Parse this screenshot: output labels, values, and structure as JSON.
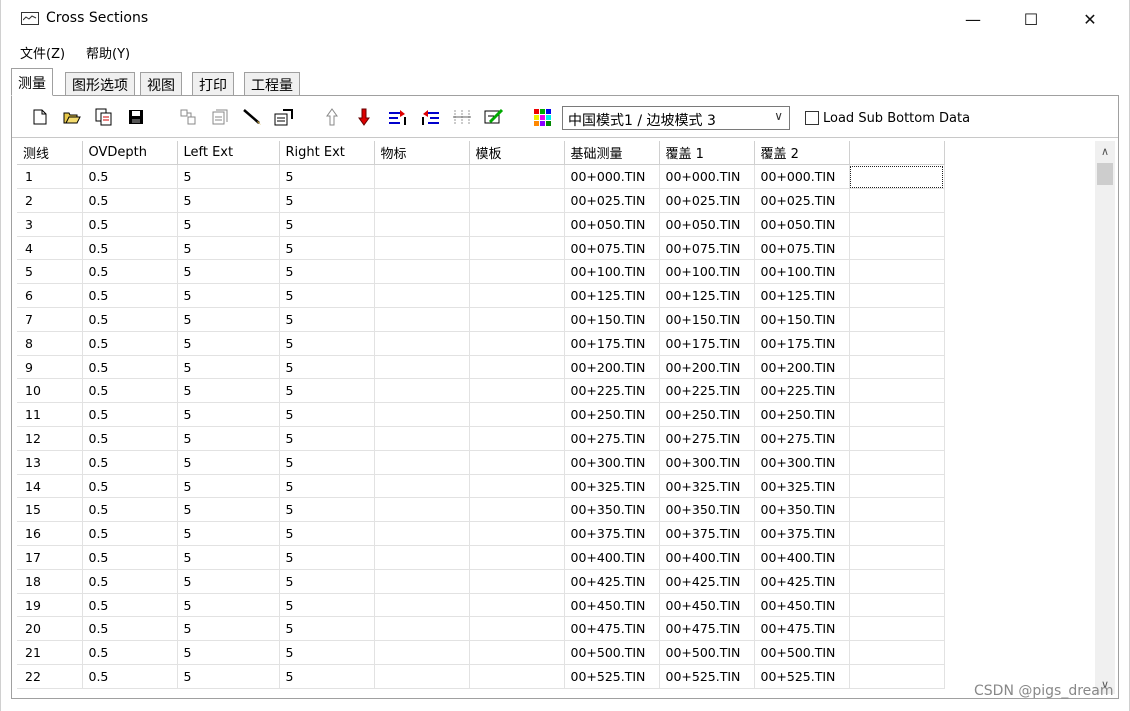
{
  "window": {
    "title": "Cross Sections",
    "controls": {
      "minimize": "—",
      "maximize": "☐",
      "close": "✕"
    }
  },
  "menu": {
    "file": "文件(Z)",
    "help": "帮助(Y)"
  },
  "tabs": [
    {
      "label": "测量",
      "active": true
    },
    {
      "label": "图形选项",
      "active": false
    },
    {
      "label": "视图",
      "active": false
    },
    {
      "label": "打印",
      "active": false
    },
    {
      "label": "工程量",
      "active": false
    }
  ],
  "toolbar": {
    "icons": [
      "new-icon",
      "open-icon",
      "import-icon",
      "save-icon",
      "tool1-icon",
      "tool2-icon",
      "pencil-icon",
      "properties-icon",
      "move-up-icon",
      "move-down-icon",
      "insert-right-icon",
      "insert-left-icon",
      "distribute-icon",
      "edit-icon",
      "color-icon"
    ],
    "template_select": "中国模式1 / 边坡模式 3",
    "load_sub_bottom_label": "Load Sub Bottom Data",
    "load_sub_bottom_checked": false
  },
  "grid": {
    "columns": [
      "测线",
      "OVDepth",
      "Left Ext",
      "Right Ext",
      "物标",
      "模板",
      "基础测量",
      "覆盖 1",
      "覆盖 2",
      ""
    ],
    "rows": [
      [
        "1",
        "0.5",
        "5",
        "5",
        "",
        "",
        "00+000.TIN",
        "00+000.TIN",
        "00+000.TIN",
        ""
      ],
      [
        "2",
        "0.5",
        "5",
        "5",
        "",
        "",
        "00+025.TIN",
        "00+025.TIN",
        "00+025.TIN",
        ""
      ],
      [
        "3",
        "0.5",
        "5",
        "5",
        "",
        "",
        "00+050.TIN",
        "00+050.TIN",
        "00+050.TIN",
        ""
      ],
      [
        "4",
        "0.5",
        "5",
        "5",
        "",
        "",
        "00+075.TIN",
        "00+075.TIN",
        "00+075.TIN",
        ""
      ],
      [
        "5",
        "0.5",
        "5",
        "5",
        "",
        "",
        "00+100.TIN",
        "00+100.TIN",
        "00+100.TIN",
        ""
      ],
      [
        "6",
        "0.5",
        "5",
        "5",
        "",
        "",
        "00+125.TIN",
        "00+125.TIN",
        "00+125.TIN",
        ""
      ],
      [
        "7",
        "0.5",
        "5",
        "5",
        "",
        "",
        "00+150.TIN",
        "00+150.TIN",
        "00+150.TIN",
        ""
      ],
      [
        "8",
        "0.5",
        "5",
        "5",
        "",
        "",
        "00+175.TIN",
        "00+175.TIN",
        "00+175.TIN",
        ""
      ],
      [
        "9",
        "0.5",
        "5",
        "5",
        "",
        "",
        "00+200.TIN",
        "00+200.TIN",
        "00+200.TIN",
        ""
      ],
      [
        "10",
        "0.5",
        "5",
        "5",
        "",
        "",
        "00+225.TIN",
        "00+225.TIN",
        "00+225.TIN",
        ""
      ],
      [
        "11",
        "0.5",
        "5",
        "5",
        "",
        "",
        "00+250.TIN",
        "00+250.TIN",
        "00+250.TIN",
        ""
      ],
      [
        "12",
        "0.5",
        "5",
        "5",
        "",
        "",
        "00+275.TIN",
        "00+275.TIN",
        "00+275.TIN",
        ""
      ],
      [
        "13",
        "0.5",
        "5",
        "5",
        "",
        "",
        "00+300.TIN",
        "00+300.TIN",
        "00+300.TIN",
        ""
      ],
      [
        "14",
        "0.5",
        "5",
        "5",
        "",
        "",
        "00+325.TIN",
        "00+325.TIN",
        "00+325.TIN",
        ""
      ],
      [
        "15",
        "0.5",
        "5",
        "5",
        "",
        "",
        "00+350.TIN",
        "00+350.TIN",
        "00+350.TIN",
        ""
      ],
      [
        "16",
        "0.5",
        "5",
        "5",
        "",
        "",
        "00+375.TIN",
        "00+375.TIN",
        "00+375.TIN",
        ""
      ],
      [
        "17",
        "0.5",
        "5",
        "5",
        "",
        "",
        "00+400.TIN",
        "00+400.TIN",
        "00+400.TIN",
        ""
      ],
      [
        "18",
        "0.5",
        "5",
        "5",
        "",
        "",
        "00+425.TIN",
        "00+425.TIN",
        "00+425.TIN",
        ""
      ],
      [
        "19",
        "0.5",
        "5",
        "5",
        "",
        "",
        "00+450.TIN",
        "00+450.TIN",
        "00+450.TIN",
        ""
      ],
      [
        "20",
        "0.5",
        "5",
        "5",
        "",
        "",
        "00+475.TIN",
        "00+475.TIN",
        "00+475.TIN",
        ""
      ],
      [
        "21",
        "0.5",
        "5",
        "5",
        "",
        "",
        "00+500.TIN",
        "00+500.TIN",
        "00+500.TIN",
        ""
      ],
      [
        "22",
        "0.5",
        "5",
        "5",
        "",
        "",
        "00+525.TIN",
        "00+525.TIN",
        "00+525.TIN",
        ""
      ]
    ]
  },
  "watermark": "CSDN @pigs_dream"
}
